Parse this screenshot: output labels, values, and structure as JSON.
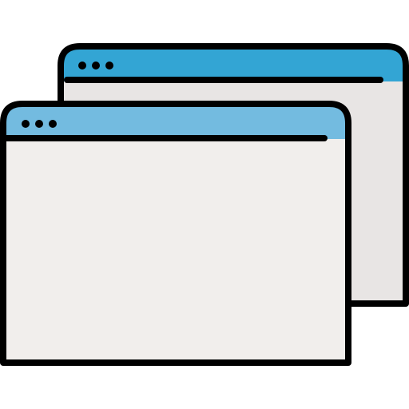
{
  "icon": {
    "name": "multiple-browser-windows-icon",
    "back_window": {
      "icon": "browser-window-icon",
      "title_bar_color": "#33A5D4",
      "body_color": "#E8E5E4",
      "control_dots": 3
    },
    "front_window": {
      "icon": "browser-window-icon",
      "title_bar_color": "#73BBE0",
      "body_color": "#F1EEEC",
      "control_dots": 3
    },
    "outline_color": "#000000"
  }
}
